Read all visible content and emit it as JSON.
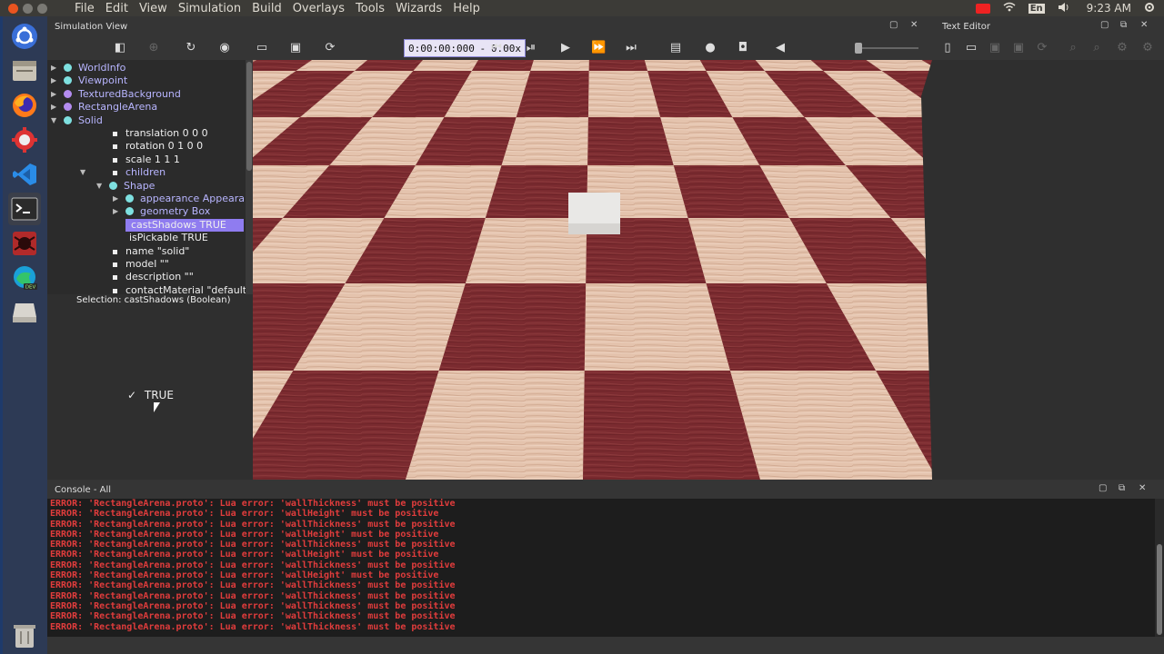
{
  "menu": [
    "File",
    "Edit",
    "View",
    "Simulation",
    "Build",
    "Overlays",
    "Tools",
    "Wizards",
    "Help"
  ],
  "tray": {
    "lang": "En",
    "clock": "9:23 AM"
  },
  "sim_panel": {
    "title": "Simulation View"
  },
  "text_panel": {
    "title": "Text Editor"
  },
  "toolbar": {
    "time": "0:00:00:000",
    "separator": "-",
    "speed": "0.00x"
  },
  "tree": [
    {
      "label": "WorldInfo",
      "kind": "node"
    },
    {
      "label": "Viewpoint",
      "kind": "node"
    },
    {
      "label": "TexturedBackground",
      "kind": "node"
    },
    {
      "label": "RectangleArena",
      "kind": "node"
    },
    {
      "label": "Solid",
      "kind": "node"
    },
    {
      "label": "translation 0 0 0",
      "kind": "field"
    },
    {
      "label": "rotation 0 1 0 0",
      "kind": "field"
    },
    {
      "label": "scale 1 1 1",
      "kind": "field"
    },
    {
      "label": "children",
      "kind": "group"
    },
    {
      "label": "Shape",
      "kind": "node"
    },
    {
      "label": "appearance Appearance",
      "kind": "node"
    },
    {
      "label": "geometry Box",
      "kind": "node"
    },
    {
      "label": "castShadows TRUE",
      "kind": "field",
      "selected": true
    },
    {
      "label": "isPickable TRUE",
      "kind": "field"
    },
    {
      "label": "name \"solid\"",
      "kind": "field"
    },
    {
      "label": "model \"\"",
      "kind": "field"
    },
    {
      "label": "description \"\"",
      "kind": "field"
    },
    {
      "label": "contactMaterial \"default\"",
      "kind": "field"
    }
  ],
  "selection": "Selection: castShadows (Boolean)",
  "field_editor": {
    "check": "✓",
    "value": "TRUE"
  },
  "console": {
    "title": "Console - All",
    "lines": [
      "ERROR: 'RectangleArena.proto': Lua error: 'wallThickness' must be positive",
      "ERROR: 'RectangleArena.proto': Lua error: 'wallHeight' must be positive",
      "ERROR: 'RectangleArena.proto': Lua error: 'wallThickness' must be positive",
      "ERROR: 'RectangleArena.proto': Lua error: 'wallHeight' must be positive",
      "ERROR: 'RectangleArena.proto': Lua error: 'wallThickness' must be positive",
      "ERROR: 'RectangleArena.proto': Lua error: 'wallHeight' must be positive",
      "ERROR: 'RectangleArena.proto': Lua error: 'wallThickness' must be positive",
      "ERROR: 'RectangleArena.proto': Lua error: 'wallHeight' must be positive",
      "ERROR: 'RectangleArena.proto': Lua error: 'wallThickness' must be positive",
      "ERROR: 'RectangleArena.proto': Lua error: 'wallThickness' must be positive",
      "ERROR: 'RectangleArena.proto': Lua error: 'wallThickness' must be positive",
      "ERROR: 'RectangleArena.proto': Lua error: 'wallThickness' must be positive",
      "ERROR: 'RectangleArena.proto': Lua error: 'wallThickness' must be positive"
    ]
  },
  "colors": {
    "accent": "#8b86d8",
    "error": "#e03c3c",
    "dark_tile": "#7a2a2e",
    "light_tile": "#e6c7b2"
  }
}
